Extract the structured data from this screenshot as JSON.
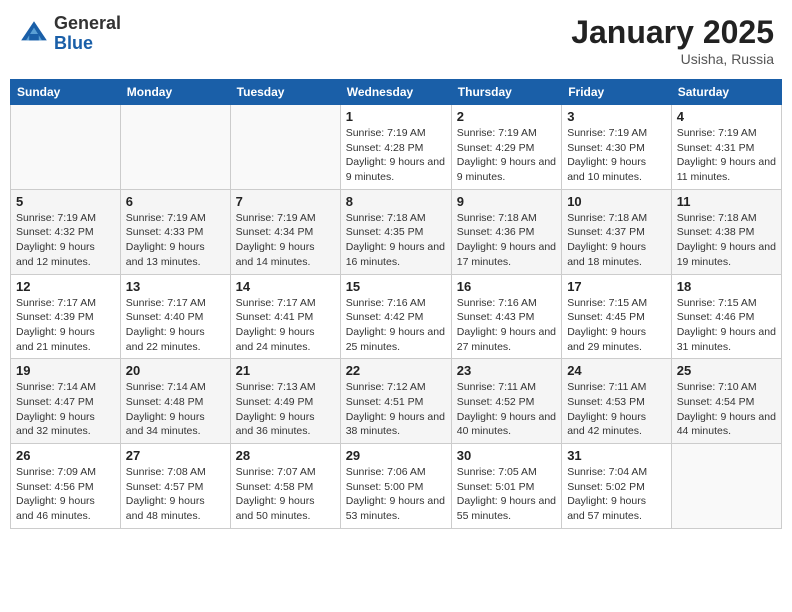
{
  "header": {
    "logo_general": "General",
    "logo_blue": "Blue",
    "month_title": "January 2025",
    "location": "Usisha, Russia"
  },
  "weekdays": [
    "Sunday",
    "Monday",
    "Tuesday",
    "Wednesday",
    "Thursday",
    "Friday",
    "Saturday"
  ],
  "weeks": [
    [
      {
        "day": "",
        "sunrise": "",
        "sunset": "",
        "daylight": ""
      },
      {
        "day": "",
        "sunrise": "",
        "sunset": "",
        "daylight": ""
      },
      {
        "day": "",
        "sunrise": "",
        "sunset": "",
        "daylight": ""
      },
      {
        "day": "1",
        "sunrise": "Sunrise: 7:19 AM",
        "sunset": "Sunset: 4:28 PM",
        "daylight": "Daylight: 9 hours and 9 minutes."
      },
      {
        "day": "2",
        "sunrise": "Sunrise: 7:19 AM",
        "sunset": "Sunset: 4:29 PM",
        "daylight": "Daylight: 9 hours and 9 minutes."
      },
      {
        "day": "3",
        "sunrise": "Sunrise: 7:19 AM",
        "sunset": "Sunset: 4:30 PM",
        "daylight": "Daylight: 9 hours and 10 minutes."
      },
      {
        "day": "4",
        "sunrise": "Sunrise: 7:19 AM",
        "sunset": "Sunset: 4:31 PM",
        "daylight": "Daylight: 9 hours and 11 minutes."
      }
    ],
    [
      {
        "day": "5",
        "sunrise": "Sunrise: 7:19 AM",
        "sunset": "Sunset: 4:32 PM",
        "daylight": "Daylight: 9 hours and 12 minutes."
      },
      {
        "day": "6",
        "sunrise": "Sunrise: 7:19 AM",
        "sunset": "Sunset: 4:33 PM",
        "daylight": "Daylight: 9 hours and 13 minutes."
      },
      {
        "day": "7",
        "sunrise": "Sunrise: 7:19 AM",
        "sunset": "Sunset: 4:34 PM",
        "daylight": "Daylight: 9 hours and 14 minutes."
      },
      {
        "day": "8",
        "sunrise": "Sunrise: 7:18 AM",
        "sunset": "Sunset: 4:35 PM",
        "daylight": "Daylight: 9 hours and 16 minutes."
      },
      {
        "day": "9",
        "sunrise": "Sunrise: 7:18 AM",
        "sunset": "Sunset: 4:36 PM",
        "daylight": "Daylight: 9 hours and 17 minutes."
      },
      {
        "day": "10",
        "sunrise": "Sunrise: 7:18 AM",
        "sunset": "Sunset: 4:37 PM",
        "daylight": "Daylight: 9 hours and 18 minutes."
      },
      {
        "day": "11",
        "sunrise": "Sunrise: 7:18 AM",
        "sunset": "Sunset: 4:38 PM",
        "daylight": "Daylight: 9 hours and 19 minutes."
      }
    ],
    [
      {
        "day": "12",
        "sunrise": "Sunrise: 7:17 AM",
        "sunset": "Sunset: 4:39 PM",
        "daylight": "Daylight: 9 hours and 21 minutes."
      },
      {
        "day": "13",
        "sunrise": "Sunrise: 7:17 AM",
        "sunset": "Sunset: 4:40 PM",
        "daylight": "Daylight: 9 hours and 22 minutes."
      },
      {
        "day": "14",
        "sunrise": "Sunrise: 7:17 AM",
        "sunset": "Sunset: 4:41 PM",
        "daylight": "Daylight: 9 hours and 24 minutes."
      },
      {
        "day": "15",
        "sunrise": "Sunrise: 7:16 AM",
        "sunset": "Sunset: 4:42 PM",
        "daylight": "Daylight: 9 hours and 25 minutes."
      },
      {
        "day": "16",
        "sunrise": "Sunrise: 7:16 AM",
        "sunset": "Sunset: 4:43 PM",
        "daylight": "Daylight: 9 hours and 27 minutes."
      },
      {
        "day": "17",
        "sunrise": "Sunrise: 7:15 AM",
        "sunset": "Sunset: 4:45 PM",
        "daylight": "Daylight: 9 hours and 29 minutes."
      },
      {
        "day": "18",
        "sunrise": "Sunrise: 7:15 AM",
        "sunset": "Sunset: 4:46 PM",
        "daylight": "Daylight: 9 hours and 31 minutes."
      }
    ],
    [
      {
        "day": "19",
        "sunrise": "Sunrise: 7:14 AM",
        "sunset": "Sunset: 4:47 PM",
        "daylight": "Daylight: 9 hours and 32 minutes."
      },
      {
        "day": "20",
        "sunrise": "Sunrise: 7:14 AM",
        "sunset": "Sunset: 4:48 PM",
        "daylight": "Daylight: 9 hours and 34 minutes."
      },
      {
        "day": "21",
        "sunrise": "Sunrise: 7:13 AM",
        "sunset": "Sunset: 4:49 PM",
        "daylight": "Daylight: 9 hours and 36 minutes."
      },
      {
        "day": "22",
        "sunrise": "Sunrise: 7:12 AM",
        "sunset": "Sunset: 4:51 PM",
        "daylight": "Daylight: 9 hours and 38 minutes."
      },
      {
        "day": "23",
        "sunrise": "Sunrise: 7:11 AM",
        "sunset": "Sunset: 4:52 PM",
        "daylight": "Daylight: 9 hours and 40 minutes."
      },
      {
        "day": "24",
        "sunrise": "Sunrise: 7:11 AM",
        "sunset": "Sunset: 4:53 PM",
        "daylight": "Daylight: 9 hours and 42 minutes."
      },
      {
        "day": "25",
        "sunrise": "Sunrise: 7:10 AM",
        "sunset": "Sunset: 4:54 PM",
        "daylight": "Daylight: 9 hours and 44 minutes."
      }
    ],
    [
      {
        "day": "26",
        "sunrise": "Sunrise: 7:09 AM",
        "sunset": "Sunset: 4:56 PM",
        "daylight": "Daylight: 9 hours and 46 minutes."
      },
      {
        "day": "27",
        "sunrise": "Sunrise: 7:08 AM",
        "sunset": "Sunset: 4:57 PM",
        "daylight": "Daylight: 9 hours and 48 minutes."
      },
      {
        "day": "28",
        "sunrise": "Sunrise: 7:07 AM",
        "sunset": "Sunset: 4:58 PM",
        "daylight": "Daylight: 9 hours and 50 minutes."
      },
      {
        "day": "29",
        "sunrise": "Sunrise: 7:06 AM",
        "sunset": "Sunset: 5:00 PM",
        "daylight": "Daylight: 9 hours and 53 minutes."
      },
      {
        "day": "30",
        "sunrise": "Sunrise: 7:05 AM",
        "sunset": "Sunset: 5:01 PM",
        "daylight": "Daylight: 9 hours and 55 minutes."
      },
      {
        "day": "31",
        "sunrise": "Sunrise: 7:04 AM",
        "sunset": "Sunset: 5:02 PM",
        "daylight": "Daylight: 9 hours and 57 minutes."
      },
      {
        "day": "",
        "sunrise": "",
        "sunset": "",
        "daylight": ""
      }
    ]
  ]
}
